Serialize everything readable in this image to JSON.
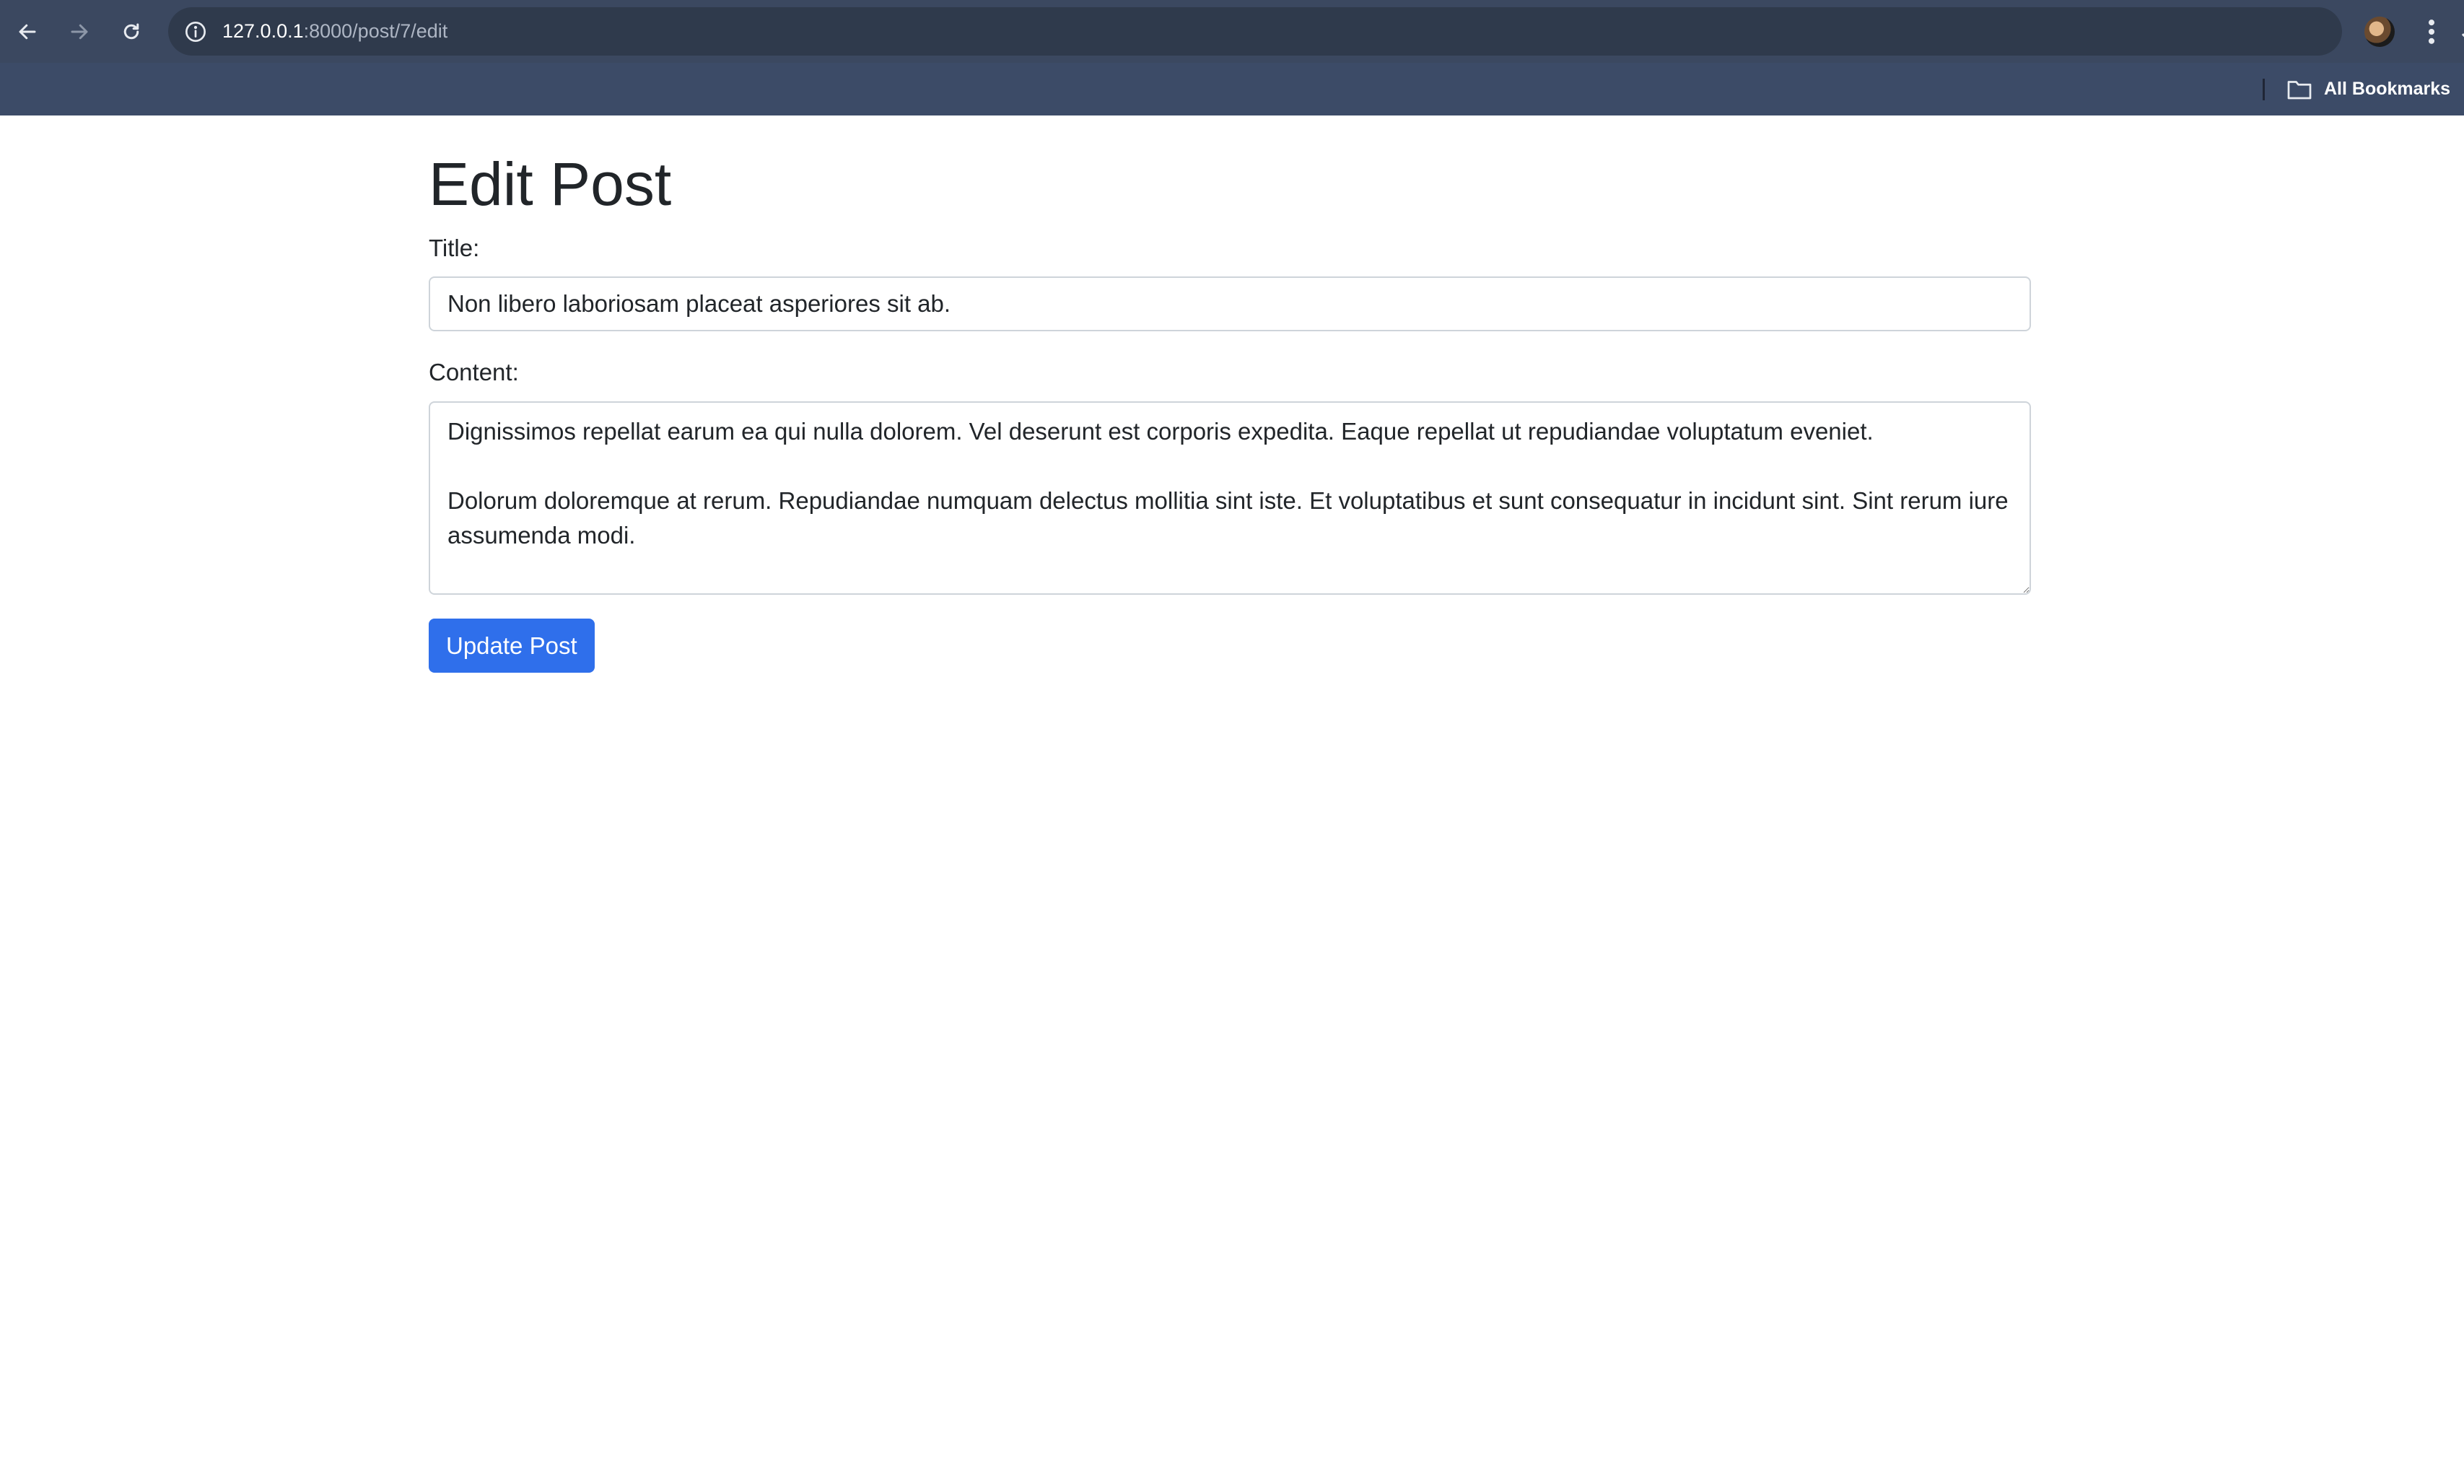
{
  "browser": {
    "url_host": "127.0.0.1",
    "url_path": ":8000/post/7/edit",
    "bookmarks_label": "All Bookmarks",
    "colors": {
      "toolbar": "#3b4860",
      "omnibox": "#2f3a4c",
      "bookmarks_bar": "#3c4b67"
    }
  },
  "icons": {
    "back": "arrow-left-icon",
    "forward": "arrow-right-icon",
    "reload": "reload-icon",
    "site_info": "info-icon",
    "bookmark_star": "star-icon",
    "menu": "kebab-menu-icon",
    "folder": "folder-icon"
  },
  "page": {
    "heading": "Edit Post",
    "title_label": "Title:",
    "title_value": "Non libero laboriosam placeat asperiores sit ab.",
    "content_label": "Content:",
    "content_value": "Dignissimos repellat earum ea qui nulla dolorem. Vel deserunt est corporis expedita. Eaque repellat ut repudiandae voluptatum eveniet.\n\nDolorum doloremque at rerum. Repudiandae numquam delectus mollitia sint iste. Et voluptatibus et sunt consequatur in incidunt sint. Sint rerum iure assumenda modi.",
    "submit_label": "Update Post",
    "accent_color": "#2f6feb"
  }
}
